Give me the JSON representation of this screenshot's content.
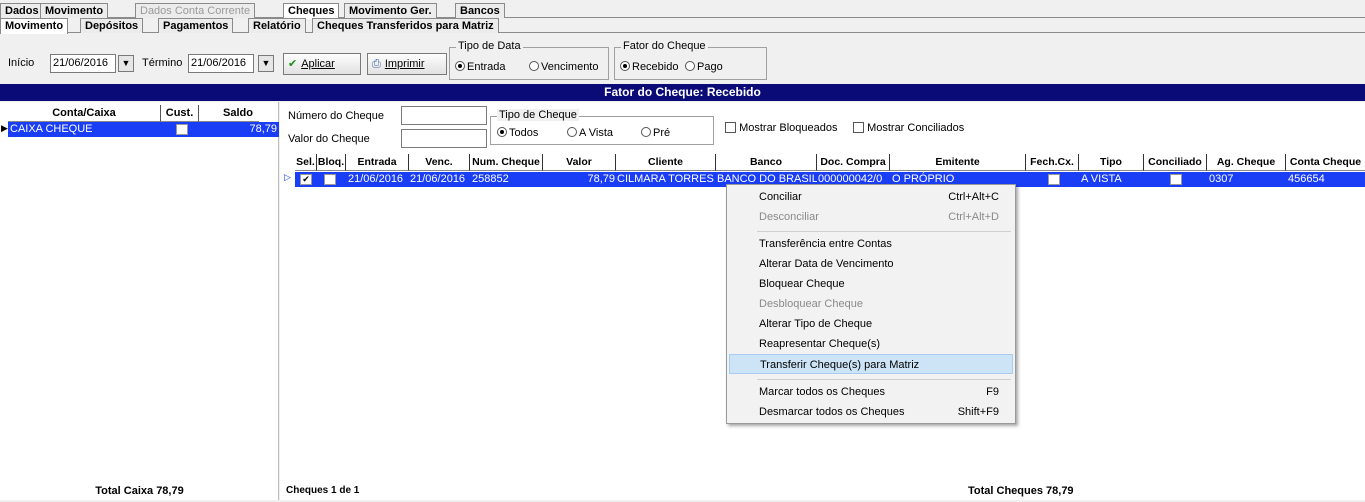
{
  "tabs_main": [
    "Dados",
    "Movimento",
    "Dados Conta Corrente",
    "Cheques",
    "Movimento Ger.",
    "Bancos"
  ],
  "tabs_sub": [
    "Movimento",
    "Depósitos",
    "Pagamentos",
    "Relatório",
    "Cheques Transferidos para Matriz"
  ],
  "toolbar": {
    "inicio_label": "Início",
    "inicio_value": "21/06/2016",
    "termino_label": "Término",
    "termino_value": "21/06/2016",
    "aplicar": "Aplicar",
    "imprimir": "Imprimir",
    "tipo_data_title": "Tipo de Data",
    "tipo_data_entrada": "Entrada",
    "tipo_data_vencimento": "Vencimento",
    "tipo_data_selected": "Entrada",
    "fator_title": "Fator do Cheque",
    "fator_recebido": "Recebido",
    "fator_pago": "Pago",
    "fator_selected": "Recebido"
  },
  "title_bar": "Fator do Cheque: Recebido",
  "left": {
    "headers": [
      "Conta/Caixa",
      "Cust.",
      "Saldo"
    ],
    "row": {
      "conta": "CAIXA CHEQUE",
      "saldo": "78,79"
    },
    "footer": "Total Caixa 78,79"
  },
  "filters": {
    "numero_label": "Número do Cheque",
    "numero_value": "",
    "valor_label": "Valor do Cheque",
    "valor_value": "",
    "tipo_title": "Tipo de Cheque",
    "tipo_todos": "Todos",
    "tipo_avista": "A Vista",
    "tipo_pre": "Pré",
    "tipo_selected": "Todos",
    "mostrar_bloqueados": "Mostrar Bloqueados",
    "mostrar_conciliados": "Mostrar Conciliados"
  },
  "grid": {
    "headers": [
      "Sel.",
      "Bloq.",
      "Entrada",
      "Venc.",
      "Num. Cheque",
      "Valor",
      "Cliente",
      "Banco",
      "Doc. Compra",
      "Emitente",
      "Fech.Cx.",
      "Tipo",
      "Conciliado",
      "Ag. Cheque",
      "Conta Cheque"
    ],
    "row": {
      "entrada": "21/06/2016",
      "venc": "21/06/2016",
      "num_cheque": "258852",
      "valor": "78,79",
      "cliente": "CILMARA TORRES",
      "banco": "BANCO DO BRASIL",
      "doc_compra": "000000042/0",
      "emitente": "O PRÓPRIO",
      "tipo": "A VISTA",
      "ag_cheque": "0307",
      "conta_cheque": "456654"
    },
    "footer_count": "Cheques 1 de 1",
    "footer_total": "Total Cheques 78,79"
  },
  "context_menu": [
    {
      "label": "Conciliar",
      "shortcut": "Ctrl+Alt+C",
      "enabled": true
    },
    {
      "label": "Desconciliar",
      "shortcut": "Ctrl+Alt+D",
      "enabled": false
    },
    {
      "label": "Transferência entre Contas",
      "shortcut": "",
      "enabled": true
    },
    {
      "label": "Alterar Data de Vencimento",
      "shortcut": "",
      "enabled": true
    },
    {
      "label": "Bloquear Cheque",
      "shortcut": "",
      "enabled": true
    },
    {
      "label": "Desbloquear Cheque",
      "shortcut": "",
      "enabled": false
    },
    {
      "label": "Alterar Tipo de Cheque",
      "shortcut": "",
      "enabled": true
    },
    {
      "label": "Reapresentar Cheque(s)",
      "shortcut": "",
      "enabled": true
    },
    {
      "label": "Transferir Cheque(s) para Matriz",
      "shortcut": "",
      "enabled": true,
      "highlighted": true
    },
    {
      "label": "Marcar todos os Cheques",
      "shortcut": "F9",
      "enabled": true
    },
    {
      "label": "Desmarcar todos os Cheques",
      "shortcut": "Shift+F9",
      "enabled": true
    }
  ],
  "colors": {
    "title_bar": "#0b0b78",
    "selection": "#1a3ef5",
    "menu_highlight": "#cde4f7"
  }
}
